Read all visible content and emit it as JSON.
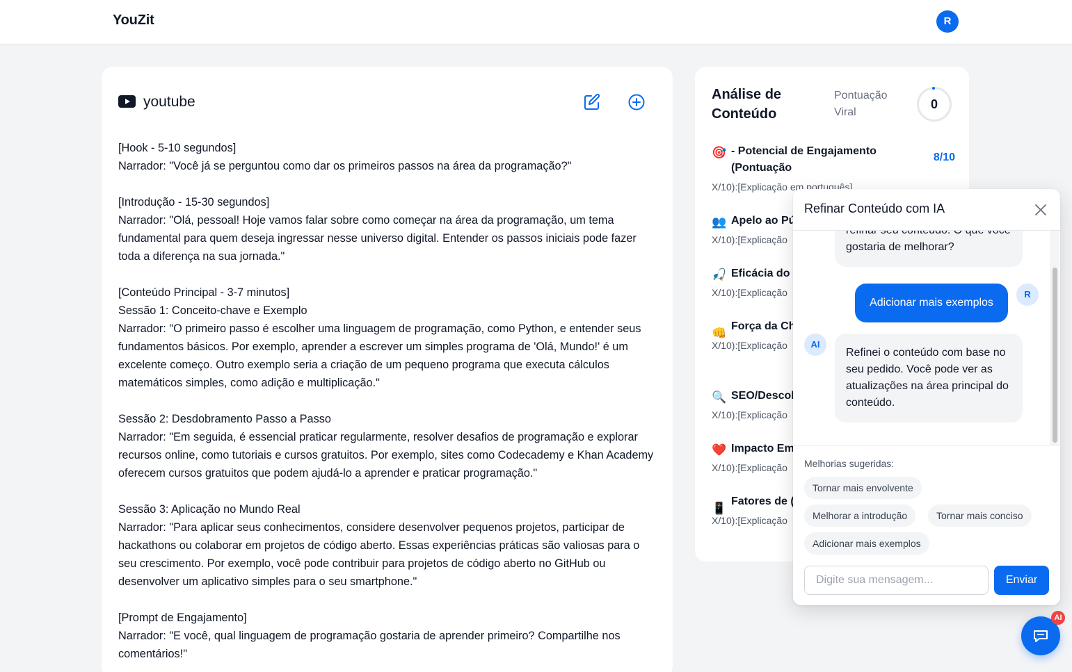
{
  "app": {
    "brand": "YouZit",
    "user_initial": "R"
  },
  "content": {
    "platform": "youtube",
    "platform_icon": "youtube-icon",
    "actions": {
      "edit_icon": "edit-icon",
      "add_icon": "plus-circle-icon"
    },
    "lines": [
      "[Hook - 5-10 segundos]",
      "Narrador: \"Você já se perguntou como dar os primeiros passos na área da programação?\"",
      "",
      "[Introdução - 15-30 segundos]",
      "Narrador: \"Olá, pessoal! Hoje vamos falar sobre como começar na área da programação, um tema fundamental para quem deseja ingressar nesse universo digital. Entender os passos iniciais pode fazer toda a diferença na sua jornada.\"",
      "",
      "[Conteúdo Principal - 3-7 minutos]",
      "Sessão 1: Conceito-chave e Exemplo",
      "Narrador: \"O primeiro passo é escolher uma linguagem de programação, como Python, e entender seus fundamentos básicos. Por exemplo, aprender a escrever um simples programa de 'Olá, Mundo!' é um excelente começo. Outro exemplo seria a criação de um pequeno programa que executa cálculos matemáticos simples, como adição e multiplicação.\"",
      "",
      "Sessão 2: Desdobramento Passo a Passo",
      "Narrador: \"Em seguida, é essencial praticar regularmente, resolver desafios de programação e explorar recursos online, como tutoriais e cursos gratuitos. Por exemplo, sites como Codecademy e Khan Academy oferecem cursos gratuitos que podem ajudá-lo a aprender e praticar programação.\"",
      "",
      "Sessão 3: Aplicação no Mundo Real",
      "Narrador: \"Para aplicar seus conhecimentos, considere desenvolver pequenos projetos, participar de hackathons ou colaborar em projetos de código aberto. Essas experiências práticas são valiosas para o seu crescimento. Por exemplo, você pode contribuir para projetos de código aberto no GitHub ou desenvolver um aplicativo simples para o seu smartphone.\"",
      "",
      "[Prompt de Engajamento]",
      "Narrador: \"E você, qual linguagem de programação gostaria de aprender primeiro? Compartilhe nos comentários!\""
    ]
  },
  "analysis": {
    "title": "Análise de Conteúdo",
    "score_label": "Pontuação Viral",
    "score_value": "0",
    "metrics": [
      {
        "emoji": "🎯",
        "name": "- Potencial de Engajamento (Pontuação",
        "score": "8/10",
        "desc": "X/10):[Explicação em português]"
      },
      {
        "emoji": "👥",
        "name": "Apelo ao Pú",
        "score": "",
        "desc": "X/10):[Explicação"
      },
      {
        "emoji": "🎣",
        "name": "Eficácia do",
        "score": "",
        "desc": "X/10):[Explicação"
      },
      {
        "emoji": "👊",
        "name": "Força da Ch (Pontuação",
        "score": "",
        "desc": "X/10):[Explicação"
      },
      {
        "emoji": "🔍",
        "name": "SEO/Descol",
        "score": "",
        "desc": "X/10):[Explicação"
      },
      {
        "emoji": "❤️",
        "name": "Impacto Em",
        "score": "",
        "desc": "X/10):[Explicação"
      },
      {
        "emoji": "📱",
        "name": "Fatores de ( (Pontuação",
        "score": "",
        "desc": "X/10):[Explicação"
      }
    ]
  },
  "chat": {
    "title": "Refinar Conteúdo com IA",
    "messages": {
      "ai_previous": "refinar seu conteúdo. O que você gostaria de melhorar?",
      "user": "Adicionar mais exemplos",
      "user_initial": "R",
      "ai_initial": "AI",
      "ai_reply": "Refinei o conteúdo com base no seu pedido. Você pode ver as atualizações na área principal do conteúdo."
    },
    "suggestions_label": "Melhorias sugeridas:",
    "suggestions": [
      "Tornar mais envolvente",
      "Melhorar a introdução",
      "Tornar mais conciso",
      "Adicionar mais exemplos"
    ],
    "input_placeholder": "Digite sua mensagem...",
    "send_label": "Enviar"
  },
  "fab": {
    "badge": "AI",
    "icon": "chat-icon"
  },
  "colors": {
    "accent": "#0b6bf0",
    "badge": "#ef4444",
    "background": "#f3f4f6"
  }
}
